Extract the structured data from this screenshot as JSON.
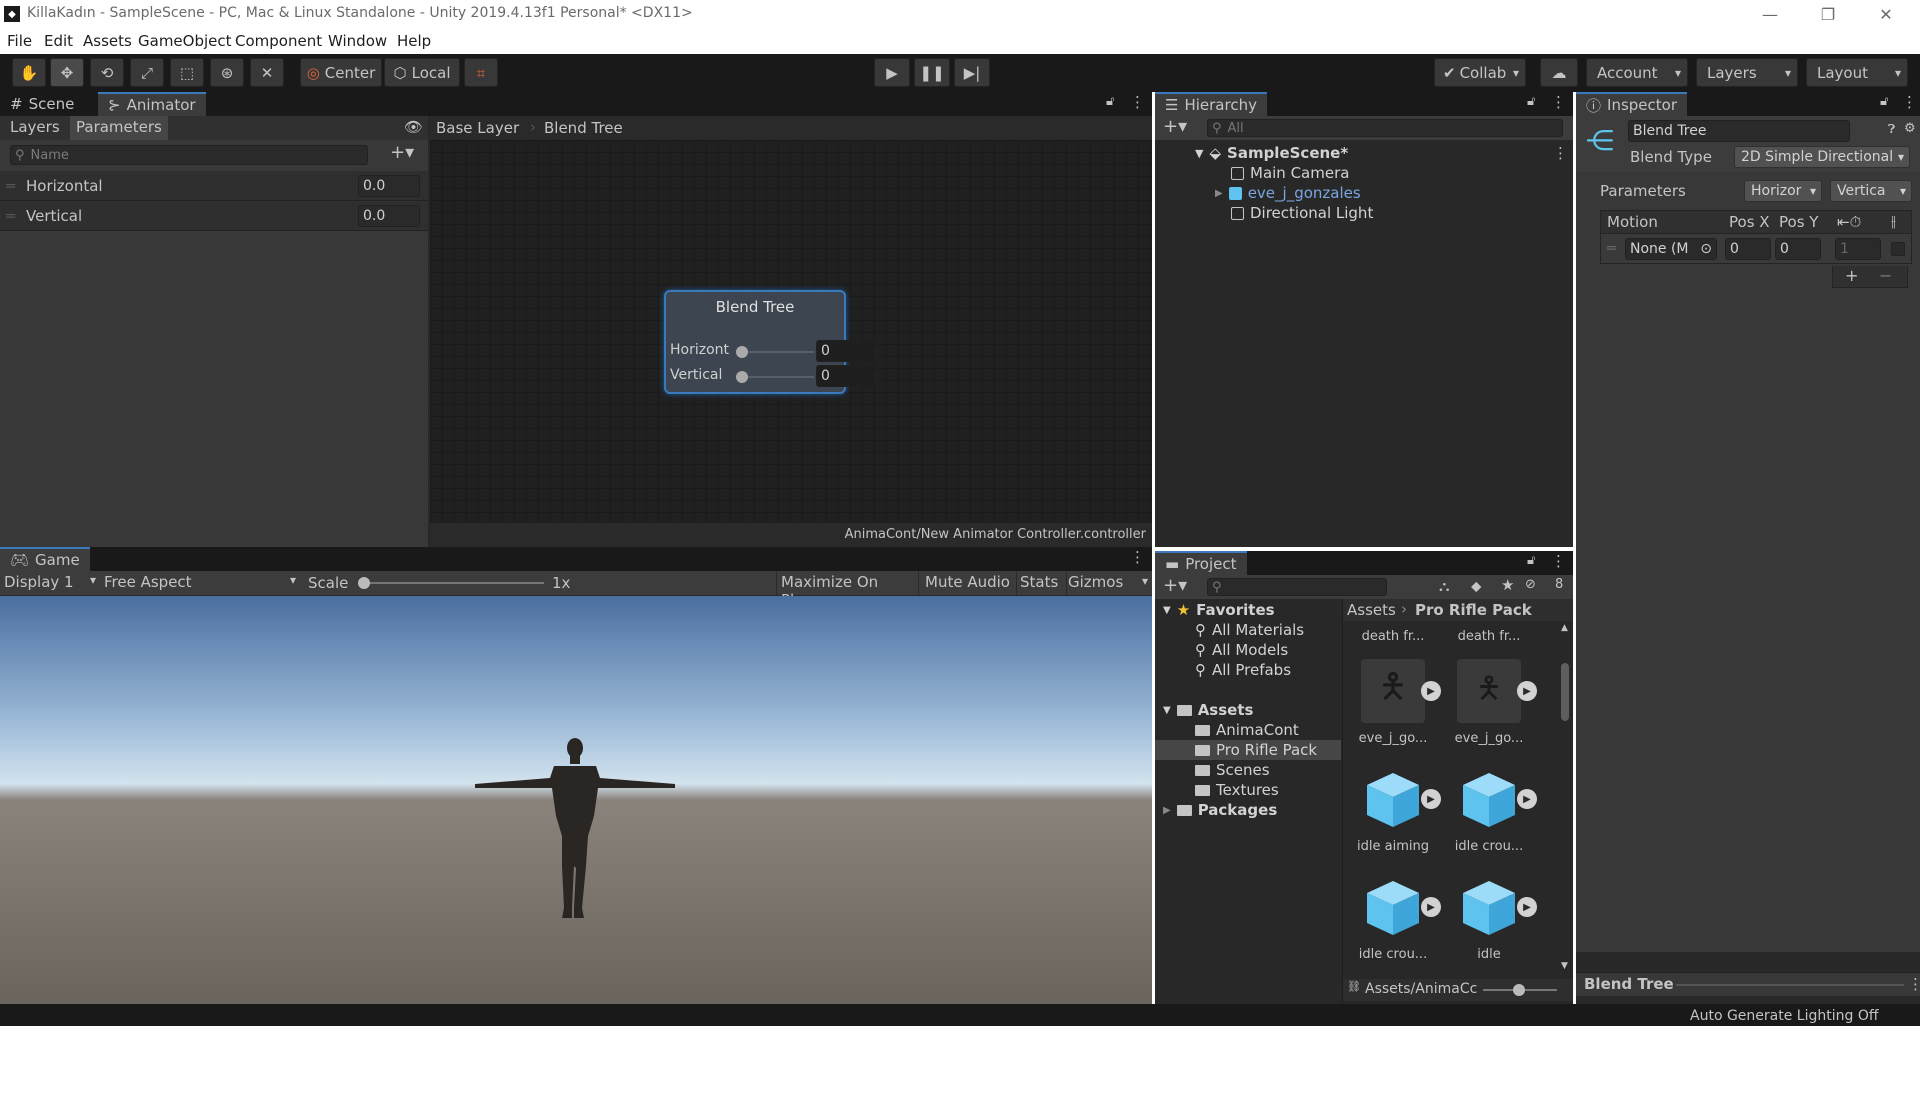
{
  "window": {
    "title": "KillaKadın - SampleScene - PC, Mac & Linux Standalone - Unity 2019.4.13f1 Personal* <DX11>",
    "minimize": "—",
    "restore": "❐",
    "close": "✕"
  },
  "menu": [
    "File",
    "Edit",
    "Assets",
    "GameObject",
    "Component",
    "Window",
    "Help"
  ],
  "toolbar": {
    "pivot_label": "Center",
    "space_label": "Local",
    "collab_label": "Collab",
    "account_label": "Account",
    "layers_label": "Layers",
    "layout_label": "Layout"
  },
  "animator_panel": {
    "tabs": [
      "Scene",
      "Animator"
    ],
    "subtabs": [
      "Layers",
      "Parameters"
    ],
    "search_placeholder": "Name",
    "parameters": [
      {
        "name": "Horizontal",
        "value": "0.0"
      },
      {
        "name": "Vertical",
        "value": "0.0"
      }
    ],
    "breadcrumb": [
      "Base Layer",
      "Blend Tree"
    ],
    "node": {
      "title": "Blend Tree",
      "params": [
        {
          "label": "Horizont",
          "value": "0"
        },
        {
          "label": "Vertical",
          "value": "0"
        }
      ]
    },
    "footer_path": "AnimaCont/New Animator Controller.controller"
  },
  "game_panel": {
    "tab": "Game",
    "display": "Display 1",
    "aspect": "Free Aspect",
    "scale_label": "Scale",
    "scale_value": "1x",
    "scale_level": 0,
    "buttons": [
      "Maximize On Play",
      "Mute Audio",
      "Stats",
      "Gizmos"
    ]
  },
  "hierarchy": {
    "tab": "Hierarchy",
    "search_placeholder": "All",
    "scene": "SampleScene*",
    "items": [
      {
        "label": "Main Camera",
        "prefab": false,
        "expandable": false
      },
      {
        "label": "eve_j_gonzales",
        "prefab": true,
        "expandable": true
      },
      {
        "label": "Directional Light",
        "prefab": false,
        "expandable": false
      }
    ]
  },
  "project": {
    "tab": "Project",
    "hidden_count": "8",
    "favorites_label": "Favorites",
    "favorites": [
      "All Materials",
      "All Models",
      "All Prefabs"
    ],
    "assets_label": "Assets",
    "folders": [
      "AnimaCont",
      "Pro Rifle Pack",
      "Scenes",
      "Textures"
    ],
    "packages_label": "Packages",
    "breadcrumb": [
      "Assets",
      "Pro Rifle Pack"
    ],
    "assets": [
      {
        "label": "death fr...",
        "kind": "partial"
      },
      {
        "label": "death fr...",
        "kind": "partial"
      },
      {
        "label": "eve_j_go...",
        "kind": "figure"
      },
      {
        "label": "eve_j_go...",
        "kind": "figure"
      },
      {
        "label": "idle aiming",
        "kind": "cube"
      },
      {
        "label": "idle crou...",
        "kind": "cube"
      },
      {
        "label": "idle crou...",
        "kind": "cube"
      },
      {
        "label": "idle",
        "kind": "cube"
      }
    ],
    "footer_path": "Assets/AnimaCc"
  },
  "inspector": {
    "tab": "Inspector",
    "name_value": "Blend Tree",
    "blend_type_label": "Blend Type",
    "blend_type_value": "2D Simple Directional",
    "parameters_label": "Parameters",
    "param_x": "Horizor",
    "param_y": "Vertica",
    "columns": [
      "Motion",
      "Pos X",
      "Pos Y"
    ],
    "motion_row": {
      "motion": "None (M",
      "pos_x": "0",
      "pos_y": "0",
      "speed": "1"
    },
    "footer_label": "Blend Tree"
  },
  "status": {
    "text": "Auto Generate Lighting Off"
  },
  "colors": {
    "accent": "#3a79bb",
    "panel": "#282828",
    "toolbar": "#191919",
    "asset_cube": "#5fc3f0",
    "prefab_text": "#7aa6e0"
  }
}
